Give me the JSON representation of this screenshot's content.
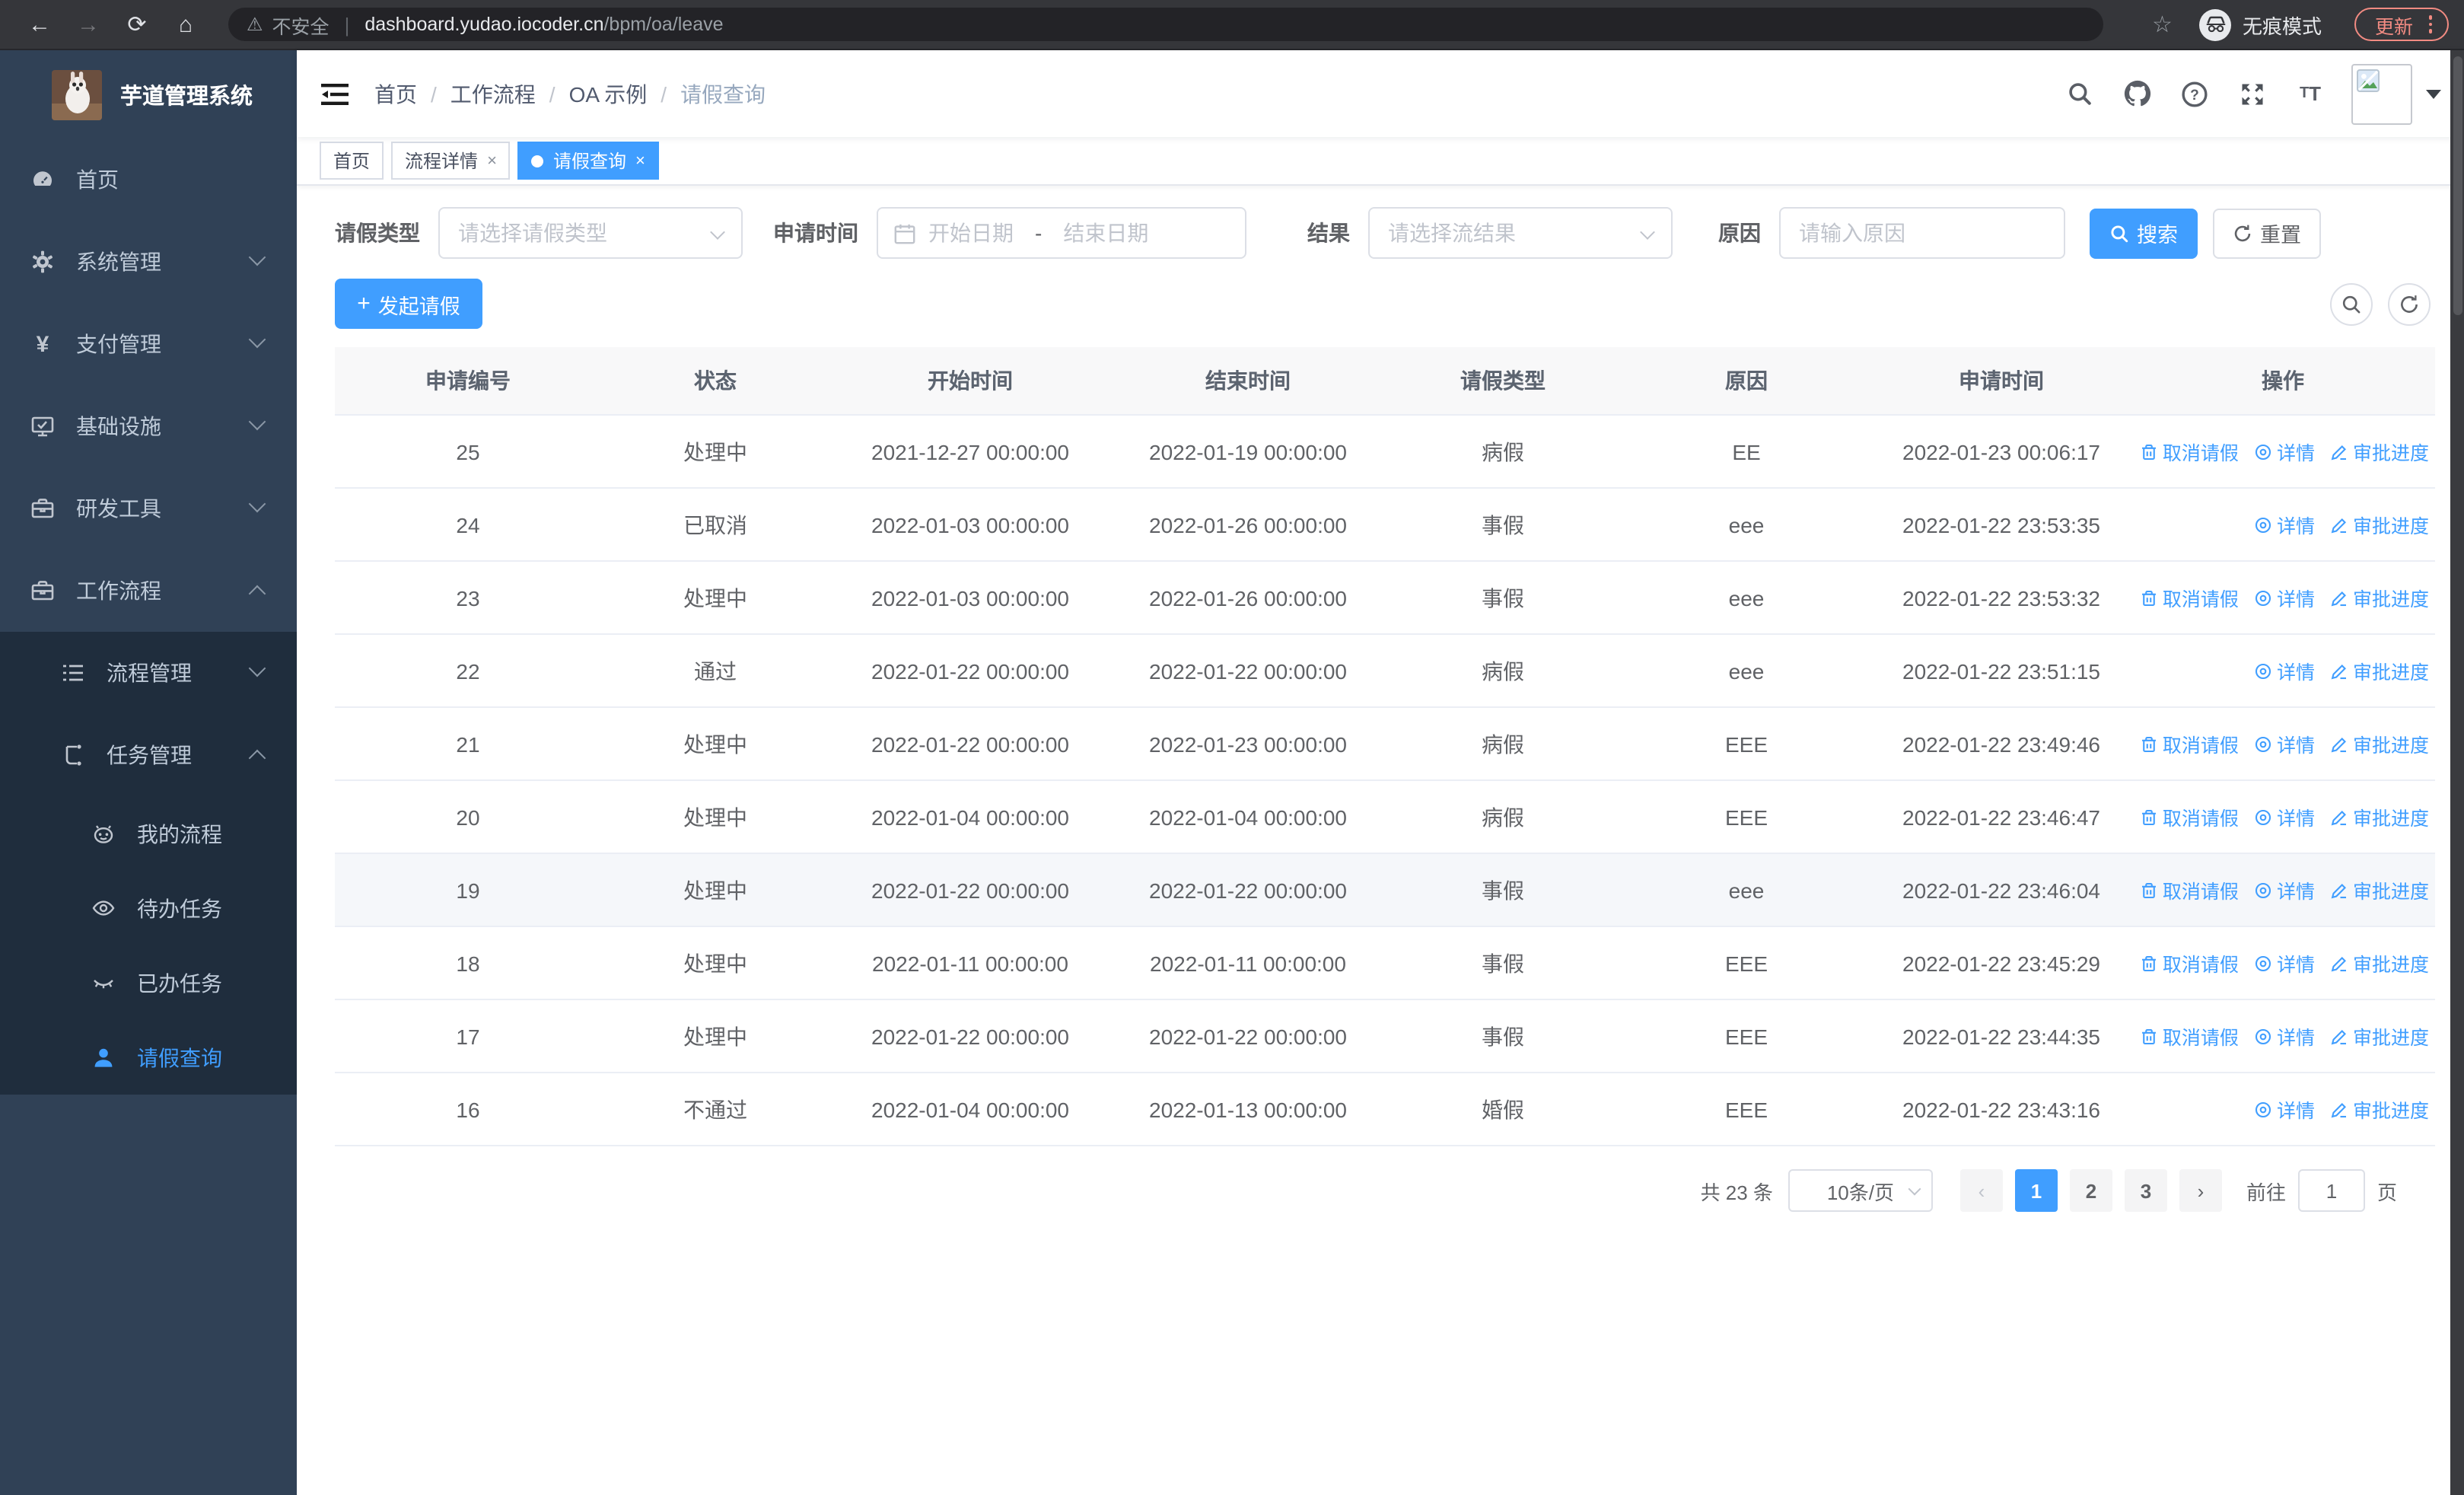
{
  "browser": {
    "security_label": "不安全",
    "url_host": "dashboard.yudao.iocoder.cn",
    "url_path": "/bpm/oa/leave",
    "incognito_label": "无痕模式",
    "update_label": "更新"
  },
  "sidebar": {
    "title": "芋道管理系统",
    "items": [
      {
        "key": "home",
        "label": "首页",
        "icon": "dashboard-icon",
        "level": 1,
        "chevron": "",
        "active": false
      },
      {
        "key": "system",
        "label": "系统管理",
        "icon": "gear-icon",
        "level": 1,
        "chevron": "down",
        "active": false
      },
      {
        "key": "payment",
        "label": "支付管理",
        "icon": "yen-icon",
        "level": 1,
        "chevron": "down",
        "active": false
      },
      {
        "key": "infra",
        "label": "基础设施",
        "icon": "monitor-check-icon",
        "level": 1,
        "chevron": "down",
        "active": false
      },
      {
        "key": "devtools",
        "label": "研发工具",
        "icon": "briefcase-icon",
        "level": 1,
        "chevron": "down",
        "active": false
      },
      {
        "key": "workflow",
        "label": "工作流程",
        "icon": "briefcase-icon",
        "level": 1,
        "chevron": "up",
        "active": false
      },
      {
        "key": "process-mgmt",
        "label": "流程管理",
        "icon": "list-icon",
        "level": 2,
        "chevron": "down",
        "active": false
      },
      {
        "key": "task-mgmt",
        "label": "任务管理",
        "icon": "org-icon",
        "level": 2,
        "chevron": "up",
        "active": false
      },
      {
        "key": "my-process",
        "label": "我的流程",
        "icon": "face-icon",
        "level": 3,
        "chevron": "",
        "active": false
      },
      {
        "key": "todo-tasks",
        "label": "待办任务",
        "icon": "eye-icon",
        "level": 3,
        "chevron": "",
        "active": false
      },
      {
        "key": "done-tasks",
        "label": "已办任务",
        "icon": "eye-closed-icon",
        "level": 3,
        "chevron": "",
        "active": false
      },
      {
        "key": "leave-query",
        "label": "请假查询",
        "icon": "user-icon",
        "level": 3,
        "chevron": "",
        "active": true
      }
    ]
  },
  "navbar": {
    "breadcrumb": [
      {
        "label": "首页",
        "muted": false
      },
      {
        "label": "工作流程",
        "muted": false
      },
      {
        "label": "OA 示例",
        "muted": false
      },
      {
        "label": "请假查询",
        "muted": true
      }
    ],
    "icons": [
      "search-icon",
      "github-icon",
      "help-icon",
      "fullscreen-icon",
      "fontsize-icon"
    ]
  },
  "tabs": [
    {
      "label": "首页",
      "closable": false,
      "active": false
    },
    {
      "label": "流程详情",
      "closable": true,
      "active": false
    },
    {
      "label": "请假查询",
      "closable": true,
      "active": true
    }
  ],
  "filters": {
    "leave_type_label": "请假类型",
    "leave_type_placeholder": "请选择请假类型",
    "apply_time_label": "申请时间",
    "start_placeholder": "开始日期",
    "range_separator": "-",
    "end_placeholder": "结束日期",
    "result_label": "结果",
    "result_placeholder": "请选择流结果",
    "reason_label": "原因",
    "reason_placeholder": "请输入原因",
    "search_label": "搜索",
    "reset_label": "重置"
  },
  "toolbar": {
    "create_label": "发起请假"
  },
  "table": {
    "headers": [
      "申请编号",
      "状态",
      "开始时间",
      "结束时间",
      "请假类型",
      "原因",
      "申请时间",
      "操作"
    ],
    "action_labels": {
      "cancel": "取消请假",
      "detail": "详情",
      "progress": "审批进度"
    },
    "rows": [
      {
        "id": "25",
        "status": "处理中",
        "start": "2021-12-27 00:00:00",
        "end": "2022-01-19 00:00:00",
        "type": "病假",
        "reason": "EE",
        "applied": "2022-01-23 00:06:17",
        "actions": [
          "cancel",
          "detail",
          "progress"
        ],
        "hover": false
      },
      {
        "id": "24",
        "status": "已取消",
        "start": "2022-01-03 00:00:00",
        "end": "2022-01-26 00:00:00",
        "type": "事假",
        "reason": "eee",
        "applied": "2022-01-22 23:53:35",
        "actions": [
          "detail",
          "progress"
        ],
        "hover": false
      },
      {
        "id": "23",
        "status": "处理中",
        "start": "2022-01-03 00:00:00",
        "end": "2022-01-26 00:00:00",
        "type": "事假",
        "reason": "eee",
        "applied": "2022-01-22 23:53:32",
        "actions": [
          "cancel",
          "detail",
          "progress"
        ],
        "hover": false
      },
      {
        "id": "22",
        "status": "通过",
        "start": "2022-01-22 00:00:00",
        "end": "2022-01-22 00:00:00",
        "type": "病假",
        "reason": "eee",
        "applied": "2022-01-22 23:51:15",
        "actions": [
          "detail",
          "progress"
        ],
        "hover": false
      },
      {
        "id": "21",
        "status": "处理中",
        "start": "2022-01-22 00:00:00",
        "end": "2022-01-23 00:00:00",
        "type": "病假",
        "reason": "EEE",
        "applied": "2022-01-22 23:49:46",
        "actions": [
          "cancel",
          "detail",
          "progress"
        ],
        "hover": false
      },
      {
        "id": "20",
        "status": "处理中",
        "start": "2022-01-04 00:00:00",
        "end": "2022-01-04 00:00:00",
        "type": "病假",
        "reason": "EEE",
        "applied": "2022-01-22 23:46:47",
        "actions": [
          "cancel",
          "detail",
          "progress"
        ],
        "hover": false
      },
      {
        "id": "19",
        "status": "处理中",
        "start": "2022-01-22 00:00:00",
        "end": "2022-01-22 00:00:00",
        "type": "事假",
        "reason": "eee",
        "applied": "2022-01-22 23:46:04",
        "actions": [
          "cancel",
          "detail",
          "progress"
        ],
        "hover": true
      },
      {
        "id": "18",
        "status": "处理中",
        "start": "2022-01-11 00:00:00",
        "end": "2022-01-11 00:00:00",
        "type": "事假",
        "reason": "EEE",
        "applied": "2022-01-22 23:45:29",
        "actions": [
          "cancel",
          "detail",
          "progress"
        ],
        "hover": false
      },
      {
        "id": "17",
        "status": "处理中",
        "start": "2022-01-22 00:00:00",
        "end": "2022-01-22 00:00:00",
        "type": "事假",
        "reason": "EEE",
        "applied": "2022-01-22 23:44:35",
        "actions": [
          "cancel",
          "detail",
          "progress"
        ],
        "hover": false
      },
      {
        "id": "16",
        "status": "不通过",
        "start": "2022-01-04 00:00:00",
        "end": "2022-01-13 00:00:00",
        "type": "婚假",
        "reason": "EEE",
        "applied": "2022-01-22 23:43:16",
        "actions": [
          "detail",
          "progress"
        ],
        "hover": false
      }
    ]
  },
  "pagination": {
    "total_label": "共 23 条",
    "page_size_label": "10条/页",
    "pages": [
      "1",
      "2",
      "3"
    ],
    "active_page": "1",
    "prev_icon": "‹",
    "next_icon": "›",
    "goto_label": "前往",
    "goto_value": "1",
    "goto_suffix": "页"
  },
  "colors": {
    "primary": "#409eff",
    "sidebar_bg": "#304156",
    "submenu_bg": "#1f2d3d",
    "update_accent": "#f28b82"
  }
}
